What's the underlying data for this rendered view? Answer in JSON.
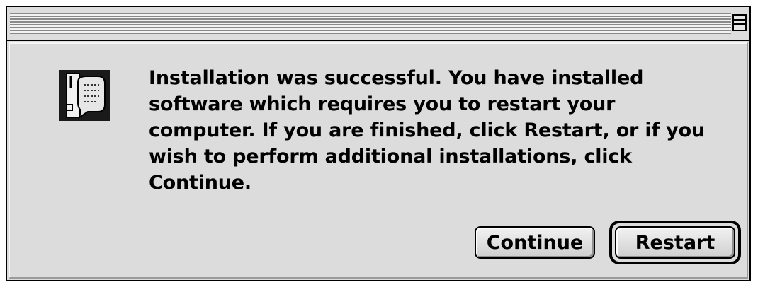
{
  "window": {
    "titlebar": {
      "collapse_icon": "windowshade-collapse-icon"
    }
  },
  "dialog": {
    "icon": "installer-note-icon",
    "message": "Installation was successful. You have installed software which requires you to restart your computer. If you are finished, click Restart, or if you wish to perform additional installations, click Continue.",
    "message_lines": [
      "Installation was successful. You have installed",
      "software which requires you to restart your",
      "computer. If you are finished, click Restart, or if you",
      "wish to perform additional installations, click",
      "Continue."
    ]
  },
  "buttons": {
    "continue_label": "Continue",
    "restart_label": "Restart",
    "default_button": "restart"
  },
  "colors": {
    "dialog_background": "#dcdcdc",
    "border": "#000000"
  }
}
